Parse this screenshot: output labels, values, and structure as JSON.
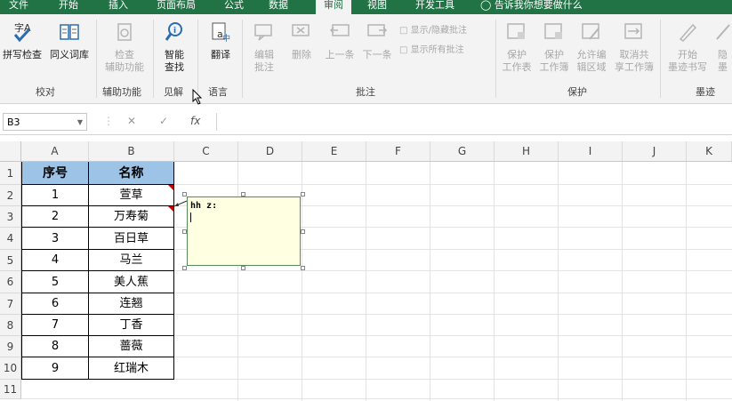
{
  "tabs": [
    {
      "label": "文件"
    },
    {
      "label": "开始"
    },
    {
      "label": "插入"
    },
    {
      "label": "页面布局"
    },
    {
      "label": "公式"
    },
    {
      "label": "数据"
    },
    {
      "label": "审阅"
    },
    {
      "label": "视图"
    },
    {
      "label": "开发工具"
    }
  ],
  "tell_me": "告诉我你想要做什么",
  "ribbon": {
    "spell": "拼写检查",
    "thesaurus": "同义词库",
    "accessibility_1": "检查",
    "accessibility_2": "辅助功能",
    "smart_1": "智能",
    "smart_2": "查找",
    "translate": "翻译",
    "edit_comment_1": "编辑",
    "edit_comment_2": "批注",
    "delete": "删除",
    "prev": "上一条",
    "next": "下一条",
    "show_hide": "显示/隐藏批注",
    "show_all": "显示所有批注",
    "protect_sheet_1": "保护",
    "protect_sheet_2": "工作表",
    "protect_wb_1": "保护",
    "protect_wb_2": "工作簿",
    "allow_edit_1": "允许编",
    "allow_edit_2": "辑区域",
    "unshare_1": "取消共",
    "unshare_2": "享工作簿",
    "ink_1": "开始",
    "ink_2": "墨迹书写",
    "hide_ink_1": "隐",
    "hide_ink_2": "墨",
    "groups": {
      "proofing": "校对",
      "accessibility": "辅助功能",
      "insights": "见解",
      "language": "语言",
      "comments": "批注",
      "protect": "保护",
      "ink": "墨迹"
    }
  },
  "formula_bar": {
    "name_box": "B3",
    "fx": "fx",
    "value": ""
  },
  "columns": [
    "A",
    "B",
    "C",
    "D",
    "E",
    "F",
    "G",
    "H",
    "I",
    "J",
    "K"
  ],
  "rows": [
    "1",
    "2",
    "3",
    "4",
    "5",
    "6",
    "7",
    "8",
    "9",
    "10",
    "11"
  ],
  "table": {
    "headers": [
      "序号",
      "名称"
    ],
    "rows": [
      [
        "1",
        "萱草"
      ],
      [
        "2",
        "万寿菊"
      ],
      [
        "3",
        "百日草"
      ],
      [
        "4",
        "马兰"
      ],
      [
        "5",
        "美人蕉"
      ],
      [
        "6",
        "连翘"
      ],
      [
        "7",
        "丁香"
      ],
      [
        "8",
        "蔷薇"
      ],
      [
        "9",
        "红瑞木"
      ]
    ]
  },
  "comment": {
    "author": "hh z:"
  },
  "colors": {
    "tab_bar": "#217346",
    "header_fill": "#9dc3e6",
    "comment_fill": "#ffffe1",
    "comment_indicator": "#c00000"
  }
}
